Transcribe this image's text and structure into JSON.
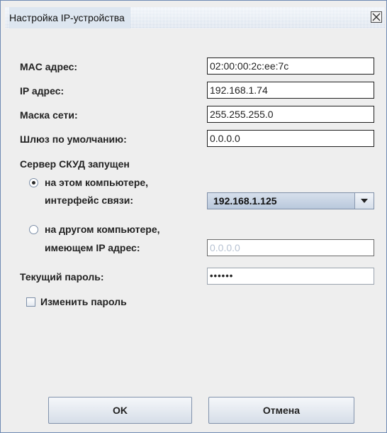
{
  "window": {
    "title": "Настройка IP-устройства"
  },
  "form": {
    "mac_label": "MAC адрес:",
    "mac_value": "02:00:00:2c:ee:7c",
    "ip_label": "IP адрес:",
    "ip_value": "192.168.1.74",
    "mask_label": "Маска сети:",
    "mask_value": "255.255.255.0",
    "gateway_label": "Шлюз по умолчанию:",
    "gateway_value": "0.0.0.0",
    "server_heading": "Сервер СКУД запущен",
    "radio_local_line1": "на этом компьютере,",
    "radio_local_line2": "интерфейс связи:",
    "radio_local_checked": true,
    "interface_selected": "192.168.1.125",
    "radio_remote_line1": "на другом компьютере,",
    "radio_remote_line2": "имеющем IP адрес:",
    "radio_remote_checked": false,
    "remote_ip_value": "0.0.0.0",
    "password_label": "Текущий пароль:",
    "password_value": "••••••",
    "change_password_label": "Изменить пароль",
    "change_password_checked": false
  },
  "buttons": {
    "ok": "OK",
    "cancel": "Отмена"
  },
  "icons": {
    "close": "close-icon",
    "dropdown": "chevron-down-icon"
  },
  "colors": {
    "accent": "#6f8bb3",
    "title_bar": "#d9e3ef",
    "background": "#eeeeee"
  }
}
